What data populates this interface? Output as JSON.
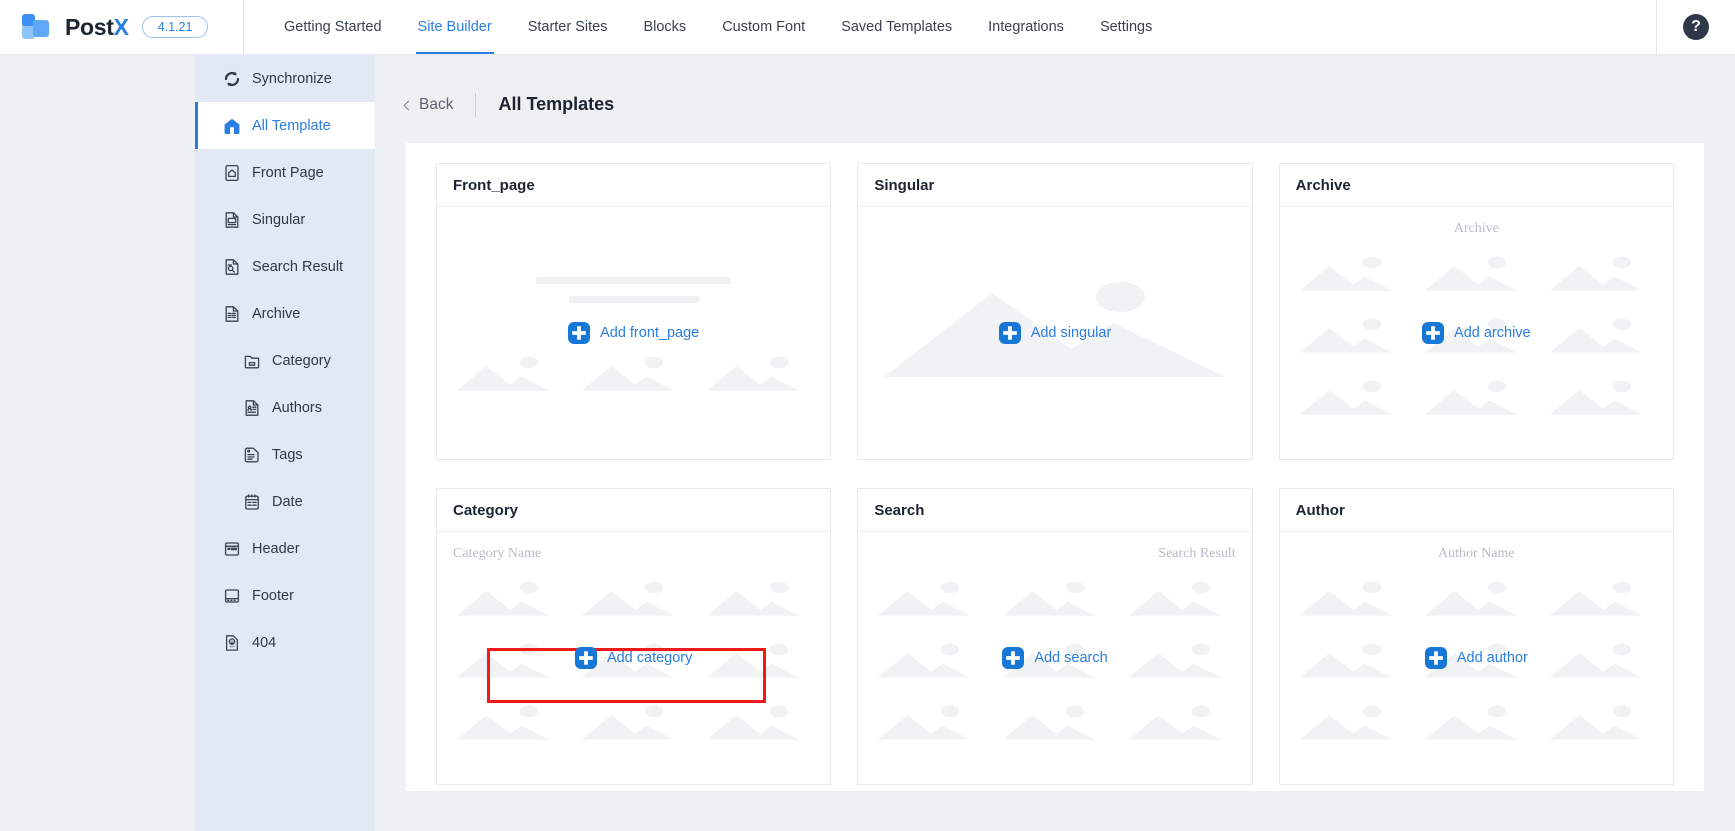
{
  "app": {
    "brand_name_main": "Post",
    "brand_name_accent": "X",
    "version": "4.1.21",
    "help_icon": "question-mark-icon"
  },
  "topnav": {
    "items": [
      {
        "label": "Getting Started",
        "active": false
      },
      {
        "label": "Site Builder",
        "active": true
      },
      {
        "label": "Starter Sites",
        "active": false
      },
      {
        "label": "Blocks",
        "active": false
      },
      {
        "label": "Custom Font",
        "active": false
      },
      {
        "label": "Saved Templates",
        "active": false
      },
      {
        "label": "Integrations",
        "active": false
      },
      {
        "label": "Settings",
        "active": false
      }
    ]
  },
  "sidebar": {
    "items": [
      {
        "label": "Synchronize",
        "icon": "sync-icon",
        "active": false,
        "sub": false
      },
      {
        "label": "All Template",
        "icon": "home-icon",
        "active": true,
        "sub": false
      },
      {
        "label": "Front Page",
        "icon": "front-page-icon",
        "active": false,
        "sub": false
      },
      {
        "label": "Singular",
        "icon": "singular-doc-icon",
        "active": false,
        "sub": false
      },
      {
        "label": "Search Result",
        "icon": "search-doc-icon",
        "active": false,
        "sub": false
      },
      {
        "label": "Archive",
        "icon": "archive-icon",
        "active": false,
        "sub": false
      },
      {
        "label": "Category",
        "icon": "category-icon",
        "active": false,
        "sub": true
      },
      {
        "label": "Authors",
        "icon": "authors-icon",
        "active": false,
        "sub": true
      },
      {
        "label": "Tags",
        "icon": "tags-icon",
        "active": false,
        "sub": true
      },
      {
        "label": "Date",
        "icon": "date-icon",
        "active": false,
        "sub": true
      },
      {
        "label": "Header",
        "icon": "header-icon",
        "active": false,
        "sub": false
      },
      {
        "label": "Footer",
        "icon": "footer-icon",
        "active": false,
        "sub": false
      },
      {
        "label": "404",
        "icon": "error-404-icon",
        "active": false,
        "sub": false
      }
    ]
  },
  "content_header": {
    "back_label": "Back",
    "title": "All Templates"
  },
  "cards": [
    {
      "title": "Front_page",
      "add_label": "Add front_page",
      "preview": "bars-and-images",
      "placeholder_text": "",
      "highlighted": false
    },
    {
      "title": "Singular",
      "add_label": "Add singular",
      "preview": "single-large-image",
      "placeholder_text": "",
      "highlighted": false
    },
    {
      "title": "Archive",
      "add_label": "Add archive",
      "preview": "image-grid",
      "placeholder_text": "Archive",
      "placeholder_align": "center",
      "highlighted": false
    },
    {
      "title": "Category",
      "add_label": "Add category",
      "preview": "image-grid",
      "placeholder_text": "Category Name",
      "placeholder_align": "left",
      "highlighted": true
    },
    {
      "title": "Search",
      "add_label": "Add search",
      "preview": "image-grid",
      "placeholder_text": "Search Result",
      "placeholder_align": "right",
      "highlighted": false
    },
    {
      "title": "Author",
      "add_label": "Add author",
      "preview": "image-grid",
      "placeholder_text": "Author Name",
      "placeholder_align": "center",
      "highlighted": false
    }
  ],
  "colors": {
    "accent": "#2a7de1",
    "highlight": "#ef1b1b",
    "sidebar_bg": "#e2e9f4",
    "page_bg": "#eef0f4",
    "placeholder_gray": "#f0f1f3"
  }
}
